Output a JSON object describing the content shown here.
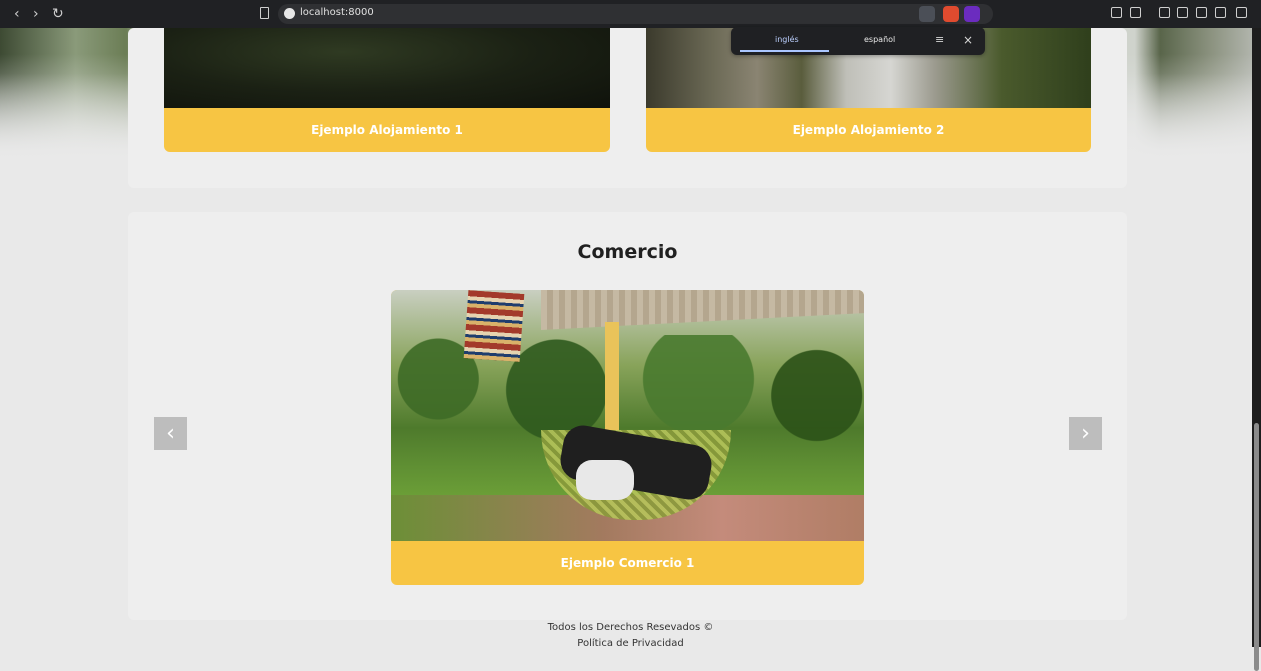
{
  "browser": {
    "url": "localhost:8000",
    "nav": {
      "back": "‹",
      "forward": "›",
      "reload": "↻"
    }
  },
  "translate_popup": {
    "tab_left": "inglés",
    "tab_right": "español",
    "menu_icon": "menu-icon",
    "close_icon": "close-icon",
    "close_glyph": "×",
    "menu_glyph": "≡"
  },
  "alojamiento": {
    "cards": [
      {
        "label": "Ejemplo Alojamiento 1"
      },
      {
        "label": "Ejemplo Alojamiento 2"
      }
    ]
  },
  "comercio": {
    "title": "Comercio",
    "card_label": "Ejemplo Comercio 1",
    "arrow_left": "‹",
    "arrow_right": "›"
  },
  "footer": {
    "rights": "Todos los Derechos Resevados ©",
    "privacy": "Política de Privacidad"
  },
  "colors": {
    "accent": "#f7c543",
    "page_bg": "#e9e9e9",
    "section_bg": "#eeeeee",
    "chrome_bg": "#202124"
  }
}
